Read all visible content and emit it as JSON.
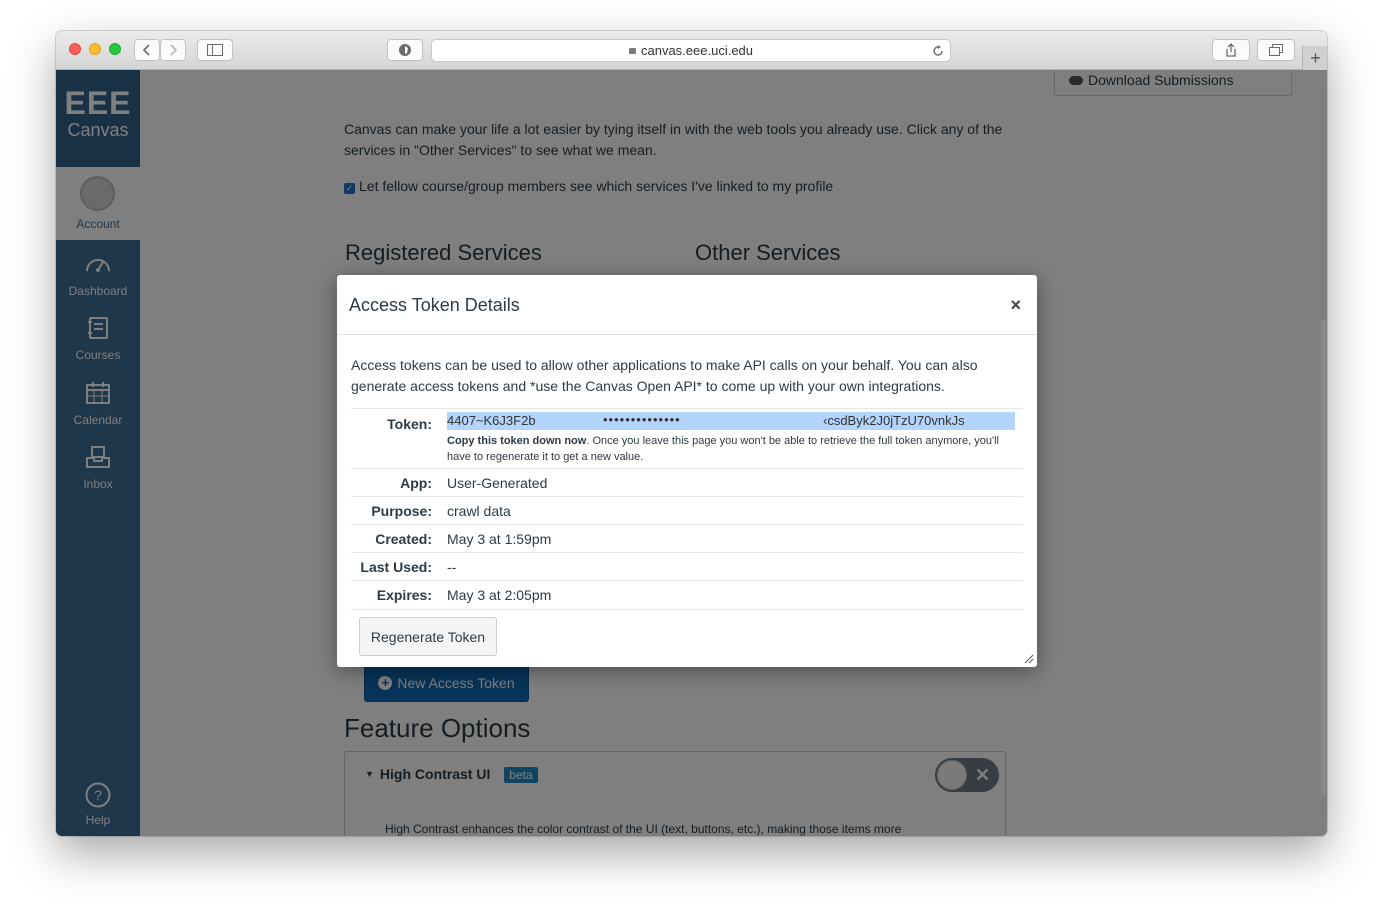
{
  "browser": {
    "url": "canvas.eee.uci.edu",
    "new_tab": "+"
  },
  "sidebar": {
    "logo_line1": "EEE",
    "logo_line2": "Canvas",
    "items": [
      {
        "label": "Account",
        "icon": "user-avatar-icon"
      },
      {
        "label": "Dashboard",
        "icon": "dashboard-gauge-icon"
      },
      {
        "label": "Courses",
        "icon": "book-icon"
      },
      {
        "label": "Calendar",
        "icon": "calendar-icon"
      },
      {
        "label": "Inbox",
        "icon": "inbox-icon"
      },
      {
        "label": "Help",
        "icon": "help-circle-icon"
      }
    ]
  },
  "page": {
    "download_submissions": "Download Submissions",
    "intro": "Canvas can make your life a lot easier by tying itself in with the web tools you already use. Click any of the services in \"Other Services\" to see what we mean.",
    "checkbox_label": "Let fellow course/group members see which services I've linked to my profile",
    "registered_services": "Registered Services",
    "other_services": "Other Services",
    "new_access_token": "New Access Token",
    "feature_options": "Feature Options",
    "feature": {
      "name": "High Contrast UI",
      "badge": "beta",
      "description": "High Contrast enhances the color contrast of the UI (text, buttons, etc.), making those items more distinct and easier to identify. Note: Institution branding will be disabled."
    }
  },
  "modal": {
    "title": "Access Token Details",
    "close": "×",
    "description": "Access tokens can be used to allow other applications to make API calls on your behalf. You can also generate access tokens and *use the Canvas Open API* to come up with your own integrations.",
    "token_label": "Token:",
    "token_start": "4407~K6J3F2b",
    "token_mask": "••••••••••••••",
    "token_end": "‹csdByk2J0jTzU70vnkJs",
    "token_note_bold": "Copy this token down now",
    "token_note": ". Once you leave this page you won't be able to retrieve the full token anymore, you'll have to regenerate it to get a new value.",
    "rows": [
      {
        "label": "App:",
        "value": "User-Generated"
      },
      {
        "label": "Purpose:",
        "value": "crawl data"
      },
      {
        "label": "Created:",
        "value": "May 3 at 1:59pm"
      },
      {
        "label": "Last Used:",
        "value": "--"
      },
      {
        "label": "Expires:",
        "value": "May 3 at 2:05pm"
      }
    ],
    "regenerate_button": "Regenerate Token"
  },
  "colors": {
    "sidebar": "#3f6f96",
    "sidebar_logo": "#33628a",
    "primary_button": "#0e68b3",
    "selection": "#b3d4fd"
  }
}
